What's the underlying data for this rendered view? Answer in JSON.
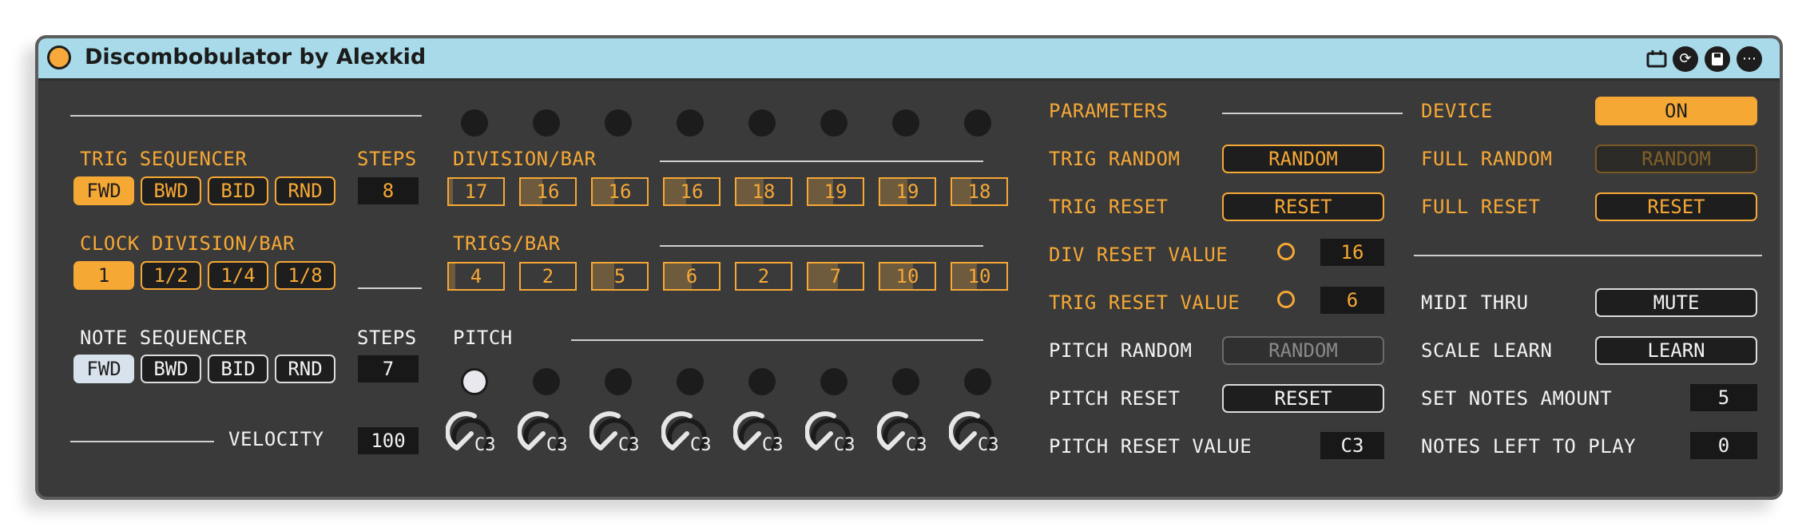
{
  "title": "Discombobulator by Alexkid",
  "title_icons": [
    "calendar-icon",
    "refresh-icon",
    "save-icon",
    "more-icon"
  ],
  "trig_seq": {
    "label": "TRIG SEQUENCER",
    "steps_label": "STEPS",
    "steps": "8",
    "modes": [
      "FWD",
      "BWD",
      "BID",
      "RND"
    ],
    "active_mode": "FWD"
  },
  "clock": {
    "label": "CLOCK DIVISION/BAR",
    "options": [
      "1",
      "1/2",
      "1/4",
      "1/8"
    ],
    "active": "1"
  },
  "note_seq": {
    "label": "NOTE SEQUENCER",
    "steps_label": "STEPS",
    "steps": "7",
    "modes": [
      "FWD",
      "BWD",
      "BID",
      "RND"
    ],
    "active_mode": "FWD"
  },
  "velocity": {
    "label": "VELOCITY",
    "value": "100"
  },
  "division": {
    "label": "DIVISION/BAR",
    "values": [
      "17",
      "16",
      "16",
      "16",
      "18",
      "19",
      "19",
      "18"
    ],
    "fill": [
      0.07,
      0.4,
      0.4,
      0.4,
      0.5,
      0.45,
      0.5,
      0.35
    ]
  },
  "trigs": {
    "label": "TRIGS/BAR",
    "values": [
      "4",
      "2",
      "5",
      "6",
      "2",
      "7",
      "10",
      "10"
    ],
    "fill": [
      0.12,
      0.0,
      0.4,
      0.5,
      0.0,
      0.55,
      0.6,
      0.45
    ]
  },
  "pitch": {
    "label": "PITCH",
    "notes": [
      "C3",
      "C3",
      "C3",
      "C3",
      "C3",
      "C3",
      "C3",
      "C3"
    ],
    "active_step": 0
  },
  "parameters": {
    "label": "PARAMETERS",
    "trig_random": {
      "label": "TRIG RANDOM",
      "button": "RANDOM"
    },
    "trig_reset": {
      "label": "TRIG RESET",
      "button": "RESET"
    },
    "div_reset_value": {
      "label": "DIV RESET VALUE",
      "value": "16"
    },
    "trig_reset_value": {
      "label": "TRIG RESET VALUE",
      "value": "6"
    },
    "pitch_random": {
      "label": "PITCH RANDOM",
      "button": "RANDOM"
    },
    "pitch_reset": {
      "label": "PITCH RESET",
      "button": "RESET"
    },
    "pitch_reset_value": {
      "label": "PITCH RESET VALUE",
      "value": "C3"
    }
  },
  "device": {
    "label": "DEVICE",
    "on": "ON",
    "full_random": {
      "label": "FULL RANDOM",
      "button": "RANDOM"
    },
    "full_reset": {
      "label": "FULL RESET",
      "button": "RESET"
    },
    "midi_thru": {
      "label": "MIDI THRU",
      "button": "MUTE"
    },
    "scale_learn": {
      "label": "SCALE LEARN",
      "button": "LEARN"
    },
    "set_notes_amount": {
      "label": "SET NOTES AMOUNT",
      "value": "5"
    },
    "notes_left": {
      "label": "NOTES LEFT TO PLAY",
      "value": "0"
    }
  },
  "colors": {
    "accent": "#f6a835",
    "panel": "#3a3a3a",
    "titlebar": "#a8dae9"
  }
}
